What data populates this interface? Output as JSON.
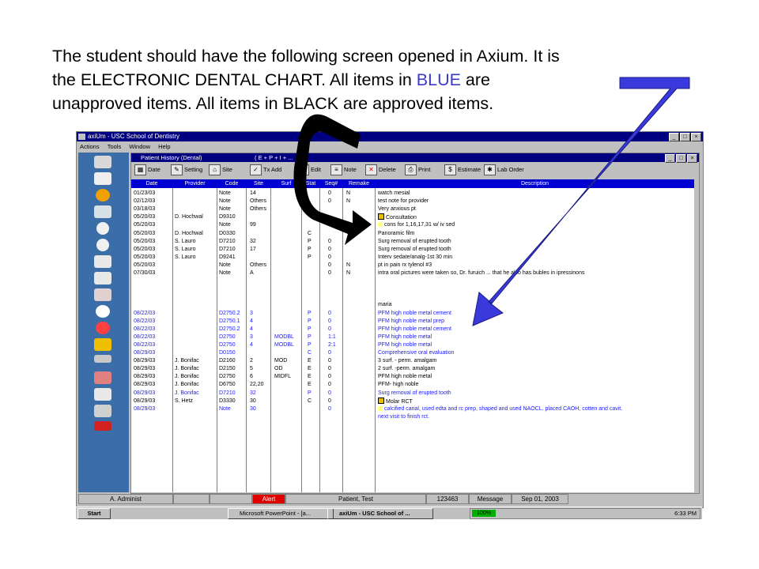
{
  "caption": {
    "line1": "The student should have the following screen opened in Axium.  It is",
    "line2_a": "the ELECTRONIC DENTAL CHART.  All items in ",
    "line2_blue": "BLUE",
    "line2_b": " are",
    "line3": "unapproved items.  All items in BLACK are approved items."
  },
  "app": {
    "title": "axiUm - USC School of Dentistry",
    "menu": [
      "Actions",
      "Tools",
      "Window",
      "Help"
    ],
    "win_buttons": [
      "_",
      "□",
      "×"
    ]
  },
  "child": {
    "title": "Patient History (Dental)",
    "filter": "( E + P + I + ...",
    "win_buttons": [
      "_",
      "□",
      "×"
    ]
  },
  "toolbar": [
    "Date",
    "Setting",
    "Site",
    "Tx Add",
    "Edit",
    "Note",
    "Delete",
    "Print",
    "Estimate",
    "Lab Order"
  ],
  "columns": [
    "Date",
    "Provider",
    "Code",
    "Site",
    "Surf",
    "Stat",
    "Seq#",
    "Remake",
    "Description"
  ],
  "rows": [
    {
      "date": "01/23/03",
      "provider": "",
      "code": "Note",
      "site": "14",
      "surf": "",
      "stat": "",
      "seq": "0",
      "remake": "N",
      "desc": "watch mesial",
      "color": "black",
      "mark": ""
    },
    {
      "date": "02/12/03",
      "provider": "",
      "code": "Note",
      "site": "Others",
      "surf": "",
      "stat": "",
      "seq": "0",
      "remake": "N",
      "desc": "test note for provider",
      "color": "black",
      "mark": ""
    },
    {
      "date": "03/18/03",
      "provider": "",
      "code": "Note",
      "site": "Others",
      "surf": "",
      "stat": "",
      "seq": "",
      "remake": "",
      "desc": "Very anxious pt",
      "color": "black",
      "mark": ""
    },
    {
      "date": "05/20/03",
      "provider": "D. Hochwal",
      "code": "D9310",
      "site": "",
      "surf": "",
      "stat": "",
      "seq": "",
      "remake": "",
      "desc": "Consultation",
      "color": "black",
      "mark": "sq"
    },
    {
      "date": "05/20/03",
      "provider": "",
      "code": "Note",
      "site": "99",
      "surf": "",
      "stat": "",
      "seq": "",
      "remake": "",
      "desc": "cons for 1,16,17,31 w/ iv sed",
      "color": "black",
      "mark": "sq2"
    },
    {
      "date": "05/20/03",
      "provider": "D. Hochwal",
      "code": "D0330",
      "site": "",
      "surf": "",
      "stat": "C",
      "seq": "",
      "remake": "",
      "desc": "Panoramic film",
      "color": "black",
      "mark": ""
    },
    {
      "date": "05/20/03",
      "provider": "S. Lauro",
      "code": "D7210",
      "site": "32",
      "surf": "",
      "stat": "P",
      "seq": "0",
      "remake": "",
      "desc": "Surg removal of erupted tooth",
      "color": "black",
      "mark": ""
    },
    {
      "date": "05/20/03",
      "provider": "S. Lauro",
      "code": "D7210",
      "site": "17",
      "surf": "",
      "stat": "P",
      "seq": "0",
      "remake": "",
      "desc": "Surg removal of erupted tooth",
      "color": "black",
      "mark": ""
    },
    {
      "date": "05/20/03",
      "provider": "S. Lauro",
      "code": "D9241",
      "site": "",
      "surf": "",
      "stat": "P",
      "seq": "0",
      "remake": "",
      "desc": "Interv sedate/analg-1st 30 min",
      "color": "black",
      "mark": ""
    },
    {
      "date": "05/20/03",
      "provider": "",
      "code": "Note",
      "site": "Others",
      "surf": "",
      "stat": "",
      "seq": "0",
      "remake": "N",
      "desc": "pt in pain rx tylenol #3",
      "color": "black",
      "mark": ""
    },
    {
      "date": "07/30/03",
      "provider": "",
      "code": "Note",
      "site": "A",
      "surf": "",
      "stat": "",
      "seq": "0",
      "remake": "N",
      "desc": "intra oral pictures were taken so, Dr. furuich ... that he also has bubles in ipressinons",
      "color": "black",
      "mark": ""
    },
    {
      "date": "",
      "provider": "",
      "code": "",
      "site": "",
      "surf": "",
      "stat": "",
      "seq": "",
      "remake": "",
      "desc": "",
      "color": "black",
      "mark": ""
    },
    {
      "date": "",
      "provider": "",
      "code": "",
      "site": "",
      "surf": "",
      "stat": "",
      "seq": "",
      "remake": "",
      "desc": "",
      "color": "black",
      "mark": ""
    },
    {
      "date": "",
      "provider": "",
      "code": "",
      "site": "",
      "surf": "",
      "stat": "",
      "seq": "",
      "remake": "",
      "desc": "",
      "color": "black",
      "mark": ""
    },
    {
      "date": "",
      "provider": "",
      "code": "",
      "site": "",
      "surf": "",
      "stat": "",
      "seq": "",
      "remake": "",
      "desc": "maria",
      "color": "black",
      "mark": ""
    },
    {
      "date": "08/22/03",
      "provider": "",
      "code": "D2750.2",
      "site": "3",
      "surf": "",
      "stat": "P",
      "seq": "0",
      "remake": "",
      "desc": "PFM high noble metal cement",
      "color": "blue",
      "mark": ""
    },
    {
      "date": "08/22/03",
      "provider": "",
      "code": "D2750.1",
      "site": "4",
      "surf": "",
      "stat": "P",
      "seq": "0",
      "remake": "",
      "desc": "PFM high noble metal prep",
      "color": "blue",
      "mark": ""
    },
    {
      "date": "08/22/03",
      "provider": "",
      "code": "D2750.2",
      "site": "4",
      "surf": "",
      "stat": "P",
      "seq": "0",
      "remake": "",
      "desc": "PFM high noble metal cement",
      "color": "blue",
      "mark": ""
    },
    {
      "date": "08/22/03",
      "provider": "",
      "code": "D2750",
      "site": "3",
      "surf": "MODBL",
      "stat": "P",
      "seq": "1:1",
      "remake": "",
      "desc": "PFM high noble metal",
      "color": "blue",
      "mark": ""
    },
    {
      "date": "08/22/03",
      "provider": "",
      "code": "D2750",
      "site": "4",
      "surf": "MODBL",
      "stat": "P",
      "seq": "2:1",
      "remake": "",
      "desc": "PFM high noble metal",
      "color": "blue",
      "mark": ""
    },
    {
      "date": "08/29/03",
      "provider": "",
      "code": "D0150",
      "site": "",
      "surf": "",
      "stat": "C",
      "seq": "0",
      "remake": "",
      "desc": "Comprehensive oral evaluation",
      "color": "blue",
      "mark": ""
    },
    {
      "date": "08/29/03",
      "provider": "J. Bonifac",
      "code": "D2160",
      "site": "2",
      "surf": "MOD",
      "stat": "E",
      "seq": "0",
      "remake": "",
      "desc": "3 surf. - perm. amalgam",
      "color": "black",
      "mark": ""
    },
    {
      "date": "08/29/03",
      "provider": "J. Bonifac",
      "code": "D2150",
      "site": "5",
      "surf": "OD",
      "stat": "E",
      "seq": "0",
      "remake": "",
      "desc": "2 surf. -perm. amalgam",
      "color": "black",
      "mark": ""
    },
    {
      "date": "08/29/03",
      "provider": "J. Bonifac",
      "code": "D2750",
      "site": "6",
      "surf": "MIDFL",
      "stat": "E",
      "seq": "0",
      "remake": "",
      "desc": "PFM high noble metal",
      "color": "black",
      "mark": ""
    },
    {
      "date": "08/29/03",
      "provider": "J. Bonifac",
      "code": "D6750",
      "site": "22,20",
      "surf": "",
      "stat": "E",
      "seq": "0",
      "remake": "",
      "desc": "PFM- high noble",
      "color": "black",
      "mark": ""
    },
    {
      "date": "08/29/03",
      "provider": "J. Bonifac",
      "code": "D7210",
      "site": "32",
      "surf": "",
      "stat": "P",
      "seq": "0",
      "remake": "",
      "desc": "Surg removal of erupted tooth",
      "color": "blue",
      "mark": ""
    },
    {
      "date": "08/29/03",
      "provider": "S. Hetz",
      "code": "D3330",
      "site": "30",
      "surf": "",
      "stat": "C",
      "seq": "0",
      "remake": "",
      "desc": "Molar RCT",
      "color": "black",
      "mark": "sq"
    },
    {
      "date": "08/29/03",
      "provider": "",
      "code": "Note",
      "site": "30",
      "surf": "",
      "stat": "",
      "seq": "0",
      "remake": "",
      "desc": "calcified canal, used edta and rc prep, shaped and used NAOCL. placed CAOH, cotten and cavit.",
      "color": "blue",
      "mark": "sq2"
    },
    {
      "date": "",
      "provider": "",
      "code": "",
      "site": "",
      "surf": "",
      "stat": "",
      "seq": "",
      "remake": "",
      "desc": "next visit to finish rct.",
      "color": "blue",
      "mark": ""
    }
  ],
  "status": {
    "user": "A. Administ",
    "alert": "Alert",
    "patient": "Patient, Test",
    "id": "123463",
    "message": "Message",
    "date": "Sep 01, 2003"
  },
  "taskbar": {
    "start": "Start",
    "task1": "Microsoft PowerPoint - [a...",
    "task2": "axiUm - USC School of ...",
    "zoom": "100%",
    "clock": "6:33 PM"
  },
  "colors": {
    "unapproved": "#1a1aff",
    "approved": "#000000",
    "header": "#0000d0",
    "arrow": "#3a3adc"
  }
}
